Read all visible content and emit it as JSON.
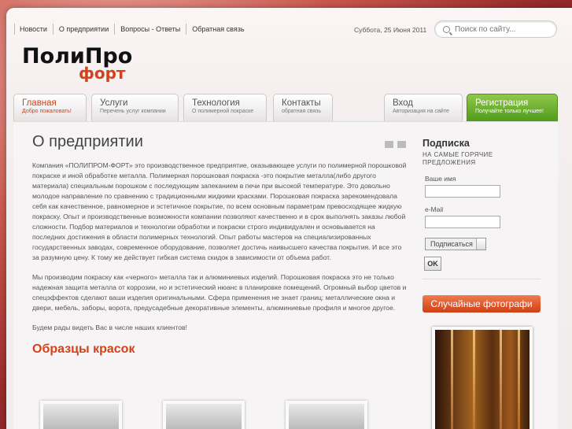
{
  "topnav": [
    "Новости",
    "О предприятии",
    "Вопросы - Ответы",
    "Обратная связь"
  ],
  "date": "Суббота, 25 Июня 2011",
  "search": {
    "placeholder": "Поиск по сайту..."
  },
  "logo": {
    "line1": "ПолиПром",
    "line2": "форт"
  },
  "tabs": [
    {
      "title": "Главная",
      "sub": "Добро пожаловать!"
    },
    {
      "title": "Услуги",
      "sub": "Перечень услуг компании"
    },
    {
      "title": "Технология",
      "sub": "О полимерной покраске"
    },
    {
      "title": "Контакты",
      "sub": "обратная связь"
    },
    {
      "title": "Вход",
      "sub": "Авторизация на сайте"
    },
    {
      "title": "Регистрация",
      "sub": "Получайте только лучшее!"
    }
  ],
  "main": {
    "title": "О предприятии",
    "p1": "Компания «ПОЛИПРОМ-ФОРТ» это производственное предприятие, оказывающее услуги по полимерной порошковой покраске и иной обработке металла. Полимерная порошковая покраска  -это покрытие металла(либо другого материала) специальным порошком с последующим запеканием в печи при высокой температуре. Это довольно молодое направление по сравнению с традиционными жидкими красками. Порошковая покраска зарекомендовала себя как качественное, равномерное и эстетичное покрытие, по всем основным параметрам превосходящее жидкую покраску. Опыт и производственные возможности компании позволяют качественно и в срок выполнять заказы любой сложности. Подбор материалов и технологии обработки и покраски строго индивидуален и основывается на последних достижения в области полимерных технологий. Опыт работы мастеров на специализированных государственных заводах, современное оборудование, позволяет достичь наивысшего качества покрытия. И все это за разумную цену. К тому же действует гибкая система скидок в зависимости от объема работ.",
    "p2": "Мы производим покраску как «черного» металла так и алюминиевых изделий. Порошковая покраска это не только надежная защита металла от коррозии, но и эстетический нюанс в планировке помещений. Огромный выбор цветов и спецэффектов сделают ваши изделия оригинальными. Сфера применения не знает границ: металлические окна и двери, мебель, заборы, ворота, предусадебные декоративные элементы, алюминиевые профиля и многое другое.",
    "p3": "Будем рады видеть Вас в числе наших клиентов!",
    "subtitle": "Образцы красок"
  },
  "sidebar": {
    "title": "Подписка",
    "caption": "НА САМЫЕ ГОРЯЧИЕ ПРЕДЛОЖЕНИЯ",
    "name_label": "Ваше имя",
    "email_label": "e-Mail",
    "select": "Подписаться",
    "ok": "OK",
    "photos_button": "Случайные фотографи"
  },
  "colors": {
    "accent": "#d2421c",
    "green": "#5aa423"
  }
}
